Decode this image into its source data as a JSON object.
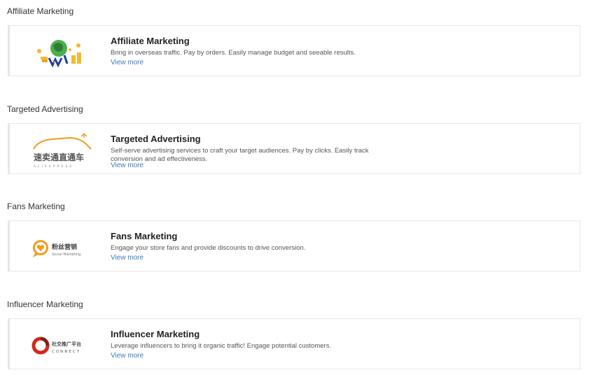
{
  "sections": [
    {
      "heading": "Affiliate Marketing",
      "card": {
        "logo": "affiliate-globe-logo",
        "title": "Affiliate Marketing",
        "description": "Bring in overseas traffic. Pay by orders. Easily manage budget and seeable results.",
        "link": "View more"
      }
    },
    {
      "heading": "Targeted Advertising",
      "card": {
        "logo": "aliexpress-direct-train-logo",
        "logo_text": "速卖通直通车",
        "logo_subtext": "ALIEXPRESS",
        "title": "Targeted Advertising",
        "description": "Self-serve advertising services to craft your target audiences. Pay by clicks. Easily track conversion and ad effectiveness.",
        "link": "View more"
      }
    },
    {
      "heading": "Fans Marketing",
      "card": {
        "logo": "fans-marketing-logo",
        "logo_text": "粉丝营销",
        "logo_subtext": "Social Marketing",
        "title": "Fans Marketing",
        "description": "Engage your store fans and provide discounts to drive conversion.",
        "link": "View more"
      }
    },
    {
      "heading": "Influencer Marketing",
      "card": {
        "logo": "connect-logo",
        "logo_text": "社交推广平台",
        "logo_subtext": "CONNECT",
        "title": "Influencer Marketing",
        "description": "Leverage influencers to bring it organic traffic! Engage potential customers.",
        "link": "View more"
      }
    }
  ],
  "colors": {
    "link": "#3a7bb8",
    "border": "#e6e6e6",
    "accent_orange": "#f39a1e",
    "accent_red": "#d7261b"
  }
}
